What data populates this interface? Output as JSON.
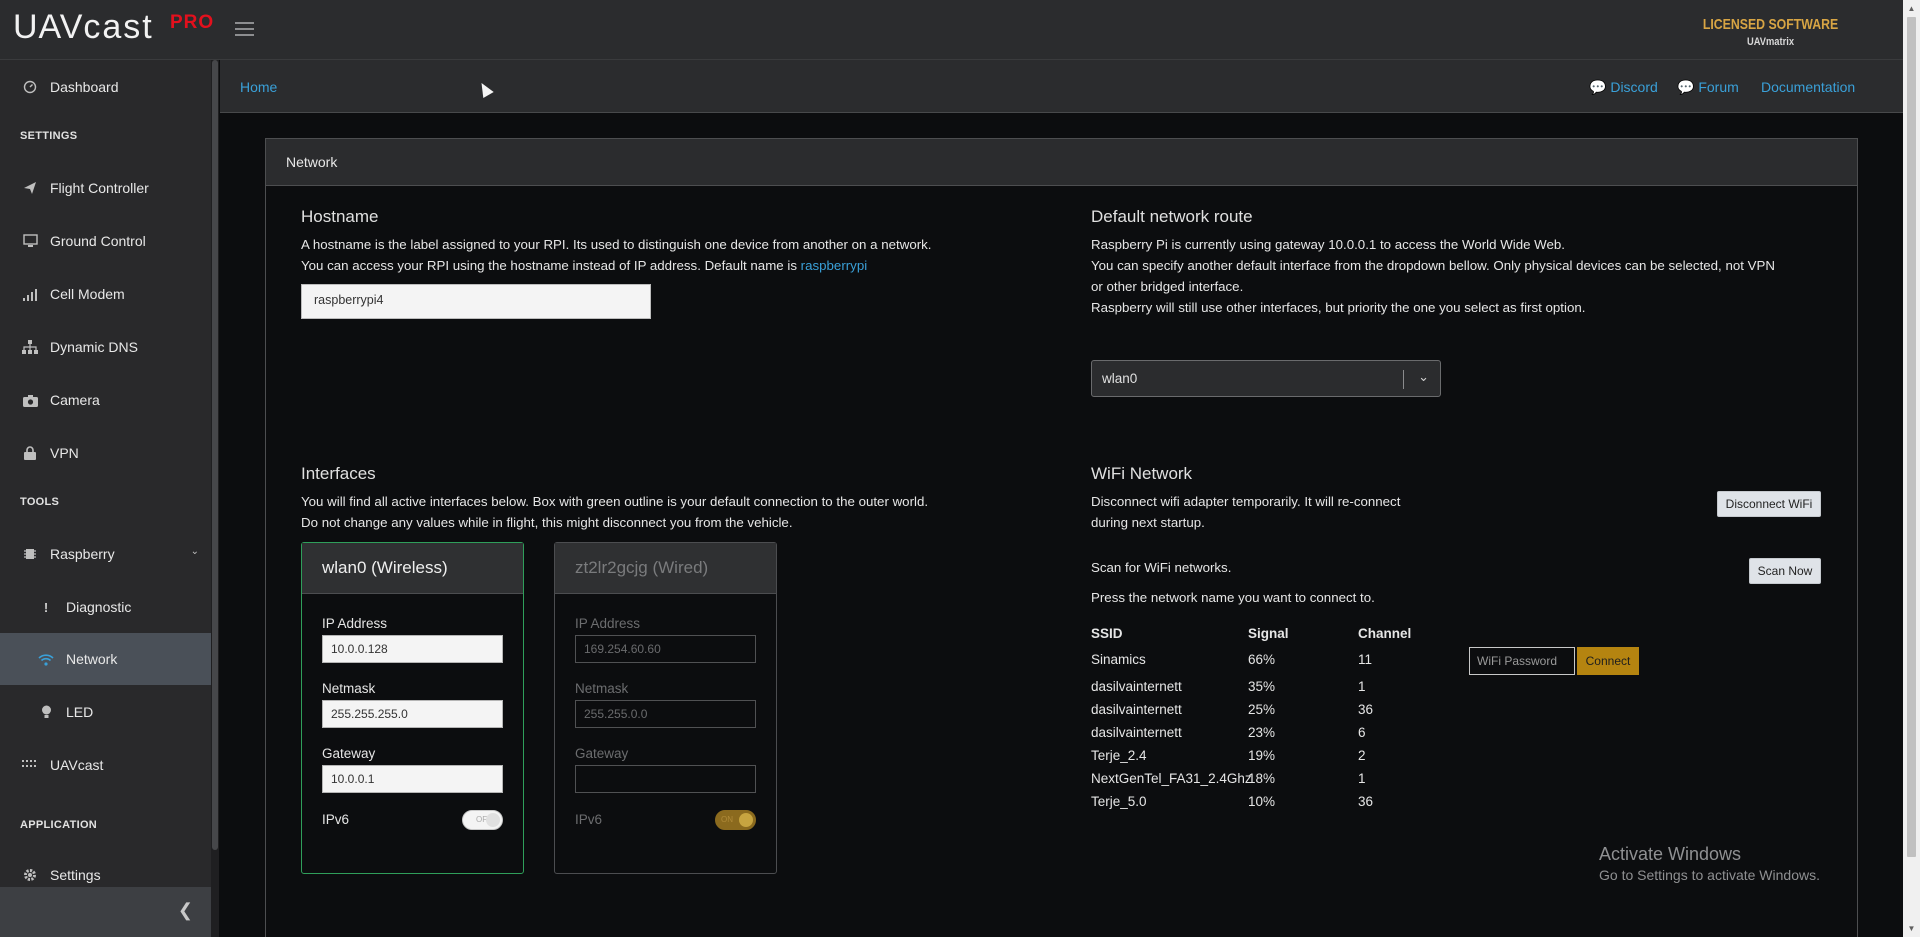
{
  "brand": {
    "uav": "UAV",
    "cast": "cast",
    "pro": "PRO",
    "license_line1": "LICENSED SOFTWARE",
    "license_line2": "UAVmatrix"
  },
  "sidebar": {
    "dashboard": "Dashboard",
    "settings_label": "SETTINGS",
    "flight_controller": "Flight Controller",
    "ground_control": "Ground Control",
    "cell_modem": "Cell Modem",
    "dynamic_dns": "Dynamic DNS",
    "camera": "Camera",
    "vpn": "VPN",
    "tools_label": "TOOLS",
    "raspberry": "Raspberry",
    "diagnostic": "Diagnostic",
    "network": "Network",
    "led": "LED",
    "uavcast": "UAVcast",
    "application_label": "APPLICATION",
    "settings": "Settings"
  },
  "breadcrumb": {
    "home": "Home",
    "discord": "Discord",
    "forum": "Forum",
    "documentation": "Documentation"
  },
  "panel": {
    "title": "Network"
  },
  "hostname": {
    "title": "Hostname",
    "line1": "A hostname is the label assigned to your RPI. Its used to distinguish one device from another on a network.",
    "line2": "You can access your RPI using the hostname instead of IP address. Default name is",
    "default_link": "raspberrypi",
    "value": "raspberrypi4"
  },
  "route": {
    "title": "Default network route",
    "line1": "Raspberry Pi is currently using gateway 10.0.0.1 to access the World Wide Web.",
    "line2": "You can specify another default interface from the dropdown bellow. Only physical devices can be selected, not VPN",
    "line3": "or other bridged interface.",
    "line4": "Raspberry will still use other interfaces, but priority the one you select as first option.",
    "selected": "wlan0"
  },
  "interfaces": {
    "title": "Interfaces",
    "line1": "You will find all active interfaces below. Box with green outline is your default connection to the outer world.",
    "line2": "Do not change any values while in flight, this might disconnect you from the vehicle.",
    "cards": [
      {
        "name": "wlan0 (Wireless)",
        "ip_label": "IP Address",
        "ip": "10.0.0.128",
        "netmask_label": "Netmask",
        "netmask": "255.255.255.0",
        "gateway_label": "Gateway",
        "gateway": "10.0.0.1",
        "ipv6_label": "IPv6",
        "ipv6_state": "OFF"
      },
      {
        "name": "zt2lr2gcjg (Wired)",
        "ip_label": "IP Address",
        "ip": "169.254.60.60",
        "netmask_label": "Netmask",
        "netmask": "255.255.0.0",
        "gateway_label": "Gateway",
        "gateway": "",
        "ipv6_label": "IPv6",
        "ipv6_state": "ON"
      }
    ]
  },
  "wifi": {
    "title": "WiFi Network",
    "disconnect_line1": "Disconnect wifi adapter temporarily. It will re-connect",
    "disconnect_line2": "during next startup.",
    "disconnect_button": "Disconnect WiFi",
    "scan_text": "Scan for WiFi networks.",
    "scan_button": "Scan Now",
    "press_text": "Press the network name you want to connect to.",
    "headers": {
      "ssid": "SSID",
      "signal": "Signal",
      "channel": "Channel"
    },
    "networks": [
      {
        "ssid": "Sinamics",
        "signal": "66%",
        "channel": "11"
      },
      {
        "ssid": "dasilvainternett",
        "signal": "35%",
        "channel": "1"
      },
      {
        "ssid": "dasilvainternett",
        "signal": "25%",
        "channel": "36"
      },
      {
        "ssid": "dasilvainternett",
        "signal": "23%",
        "channel": "6"
      },
      {
        "ssid": "Terje_2.4",
        "signal": "19%",
        "channel": "2"
      },
      {
        "ssid": "NextGenTel_FA31_2.4Ghz",
        "signal": "18%",
        "channel": "1"
      },
      {
        "ssid": "Terje_5.0",
        "signal": "10%",
        "channel": "36"
      }
    ],
    "password_placeholder": "WiFi Password",
    "connect_button": "Connect"
  },
  "watermark": {
    "line1": "Activate Windows",
    "line2": "Go to Settings to activate Windows."
  },
  "colors": {
    "accent_link": "#3aa0d8",
    "pro_red": "#e3101d",
    "license_gold": "#d8a544",
    "connect_gold": "#b58410",
    "active_green": "#2f9e5a"
  }
}
